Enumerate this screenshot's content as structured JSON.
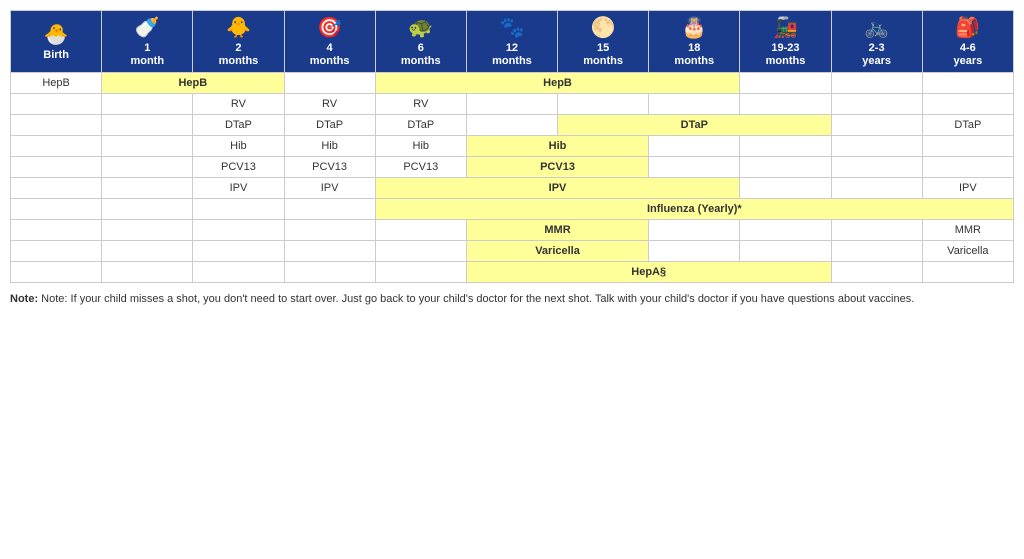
{
  "table": {
    "headers": [
      {
        "id": "birth",
        "icon": "🐣",
        "line1": "Birth",
        "line2": ""
      },
      {
        "id": "1mo",
        "icon": "🍼",
        "line1": "1",
        "line2": "month"
      },
      {
        "id": "2mo",
        "icon": "🐥",
        "line1": "2",
        "line2": "months"
      },
      {
        "id": "4mo",
        "icon": "🎯",
        "line1": "4",
        "line2": "months"
      },
      {
        "id": "6mo",
        "icon": "🐢",
        "line1": "6",
        "line2": "months"
      },
      {
        "id": "12mo",
        "icon": "🐾",
        "line1": "12",
        "line2": "months"
      },
      {
        "id": "15mo",
        "icon": "🌕",
        "line1": "15",
        "line2": "months"
      },
      {
        "id": "18mo",
        "icon": "🎂",
        "line1": "18",
        "line2": "months"
      },
      {
        "id": "1923mo",
        "icon": "🚂",
        "line1": "19-23",
        "line2": "months"
      },
      {
        "id": "23yr",
        "icon": "🚲",
        "line1": "2-3",
        "line2": "years"
      },
      {
        "id": "46yr",
        "icon": "🎒",
        "line1": "4-6",
        "line2": "years"
      }
    ],
    "note": "Note: If your child misses a shot, you don't need to start over. Just go back to your child's doctor for the next shot. Talk with your child's doctor if you have questions about vaccines."
  }
}
